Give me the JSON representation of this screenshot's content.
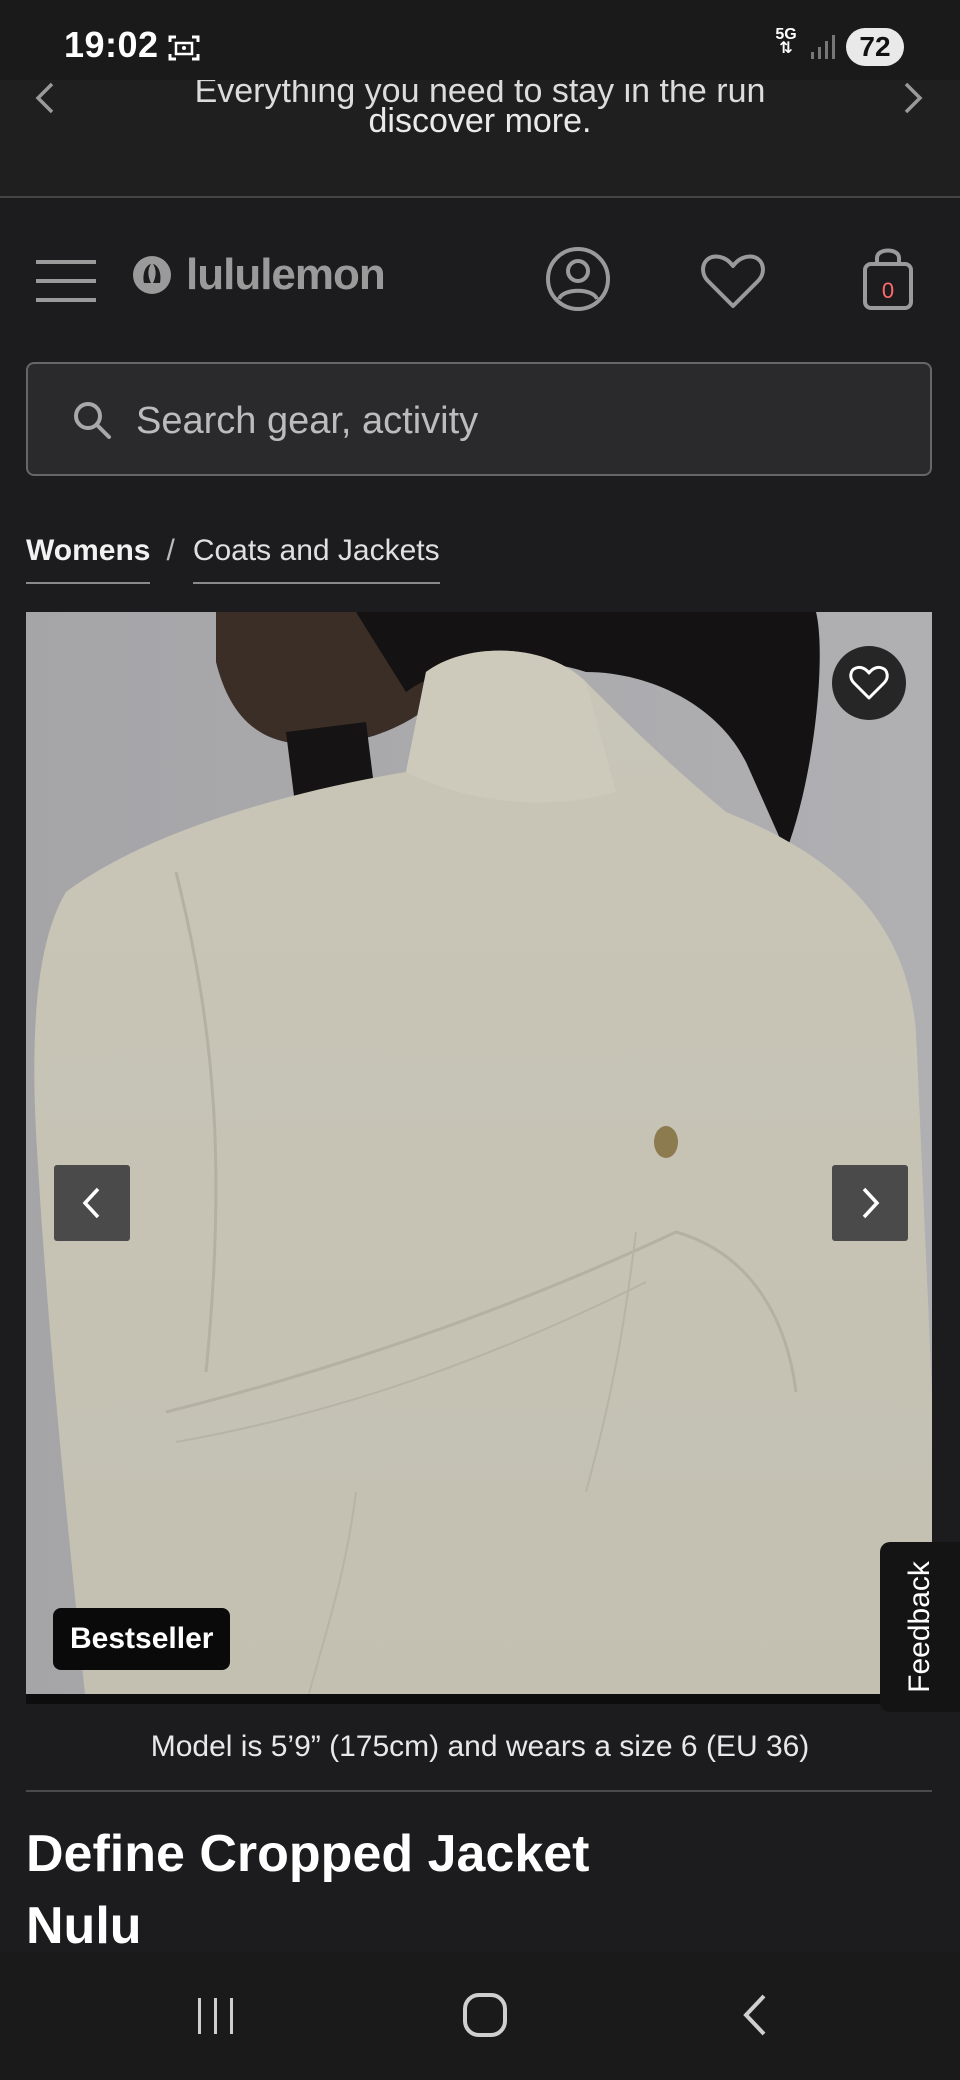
{
  "status_bar": {
    "time": "19:02",
    "network": "5G",
    "battery": "72"
  },
  "promo": {
    "line_partial": "Everything you need to stay in the run",
    "line": "discover more."
  },
  "header": {
    "brand": "lululemon",
    "bag_count": "0"
  },
  "search": {
    "placeholder": "Search gear, activity"
  },
  "breadcrumb": {
    "items": [
      "Womens",
      "Coats and Jackets"
    ],
    "separator": "/"
  },
  "product": {
    "badge": "Bestseller",
    "model_note": "Model is 5’9” (175cm) and wears a size 6 (EU 36)",
    "title_line1": "Define Cropped Jacket",
    "title_line2": "Nulu"
  },
  "feedback": {
    "label": "Feedback"
  },
  "icons": {
    "menu": "hamburger-icon",
    "account": "account-icon",
    "wishlist": "heart-icon",
    "bag": "shopping-bag-icon",
    "search": "search-icon",
    "prev": "chevron-left-icon",
    "next": "chevron-right-icon"
  },
  "colors": {
    "background": "#1c1c1e",
    "bag_count": "#ff6b6b",
    "badge": "#0a0a0a"
  }
}
